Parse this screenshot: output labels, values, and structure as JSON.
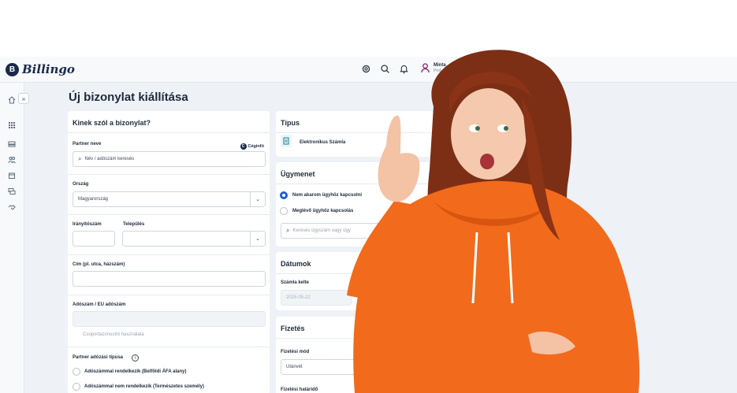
{
  "app": {
    "brand": "Billingo",
    "brand_mark": "B",
    "user": {
      "name": "Minta",
      "sub": "Prof"
    },
    "topbar_icons": [
      "gear-icon",
      "search-icon",
      "bell-icon"
    ],
    "sidebar_icons": [
      "home-icon",
      "grid-icon",
      "stack-icon",
      "users-icon",
      "box-icon",
      "cards-icon",
      "handshake-icon"
    ],
    "sidebar_expand": "»"
  },
  "page": {
    "title": "Új bizonylat kiállítása"
  },
  "left_card": {
    "heading": "Kinek szól a bizonylat?",
    "partner_label": "Partner neve",
    "ceginfo": "Céginfó",
    "ceginfo_mark": "C",
    "partner_placeholder": "Név / adószám keresés",
    "country_label": "Ország",
    "country_value": "Magyarország",
    "zip_label": "Irányítószám",
    "city_label": "Település",
    "address_label": "Cím (pl. utca, házszám)",
    "tax_label": "Adószám / EU adószám",
    "group_id_label": "Csoportazonosító használata",
    "partner_tax_type_label": "Partner adózási típusa",
    "info_glyph": "i",
    "tax_options": [
      "Adószámmal rendelkezik (Belföldi ÁFA alany)",
      "Adószámmal nem rendelkezik (Természetes személy)"
    ]
  },
  "right_cards": {
    "type_heading": "Típus",
    "type_value": "Elektronikus Számla",
    "case_heading": "Ügymenet",
    "case_options": [
      "Nem akarom ügyhöz kapcsolni",
      "Meglévő ügyhöz kapcsolás"
    ],
    "case_search_placeholder": "Keresés ügyszám vagy ügy",
    "dates_heading": "Dátumok",
    "invoice_date_label": "Számla kelte",
    "invoice_date_value": "2025-05-22",
    "payment_heading": "Fizetés",
    "payment_method_label": "Fizetési mód",
    "payment_method_value": "Utánvét",
    "payment_other_label": "O",
    "deadline_label": "Fizetési határidő"
  },
  "colors": {
    "accent": "#1f5fd0",
    "brand": "#1b2a4a",
    "hoodie": "#f26a1b",
    "hair": "#8a3317"
  }
}
